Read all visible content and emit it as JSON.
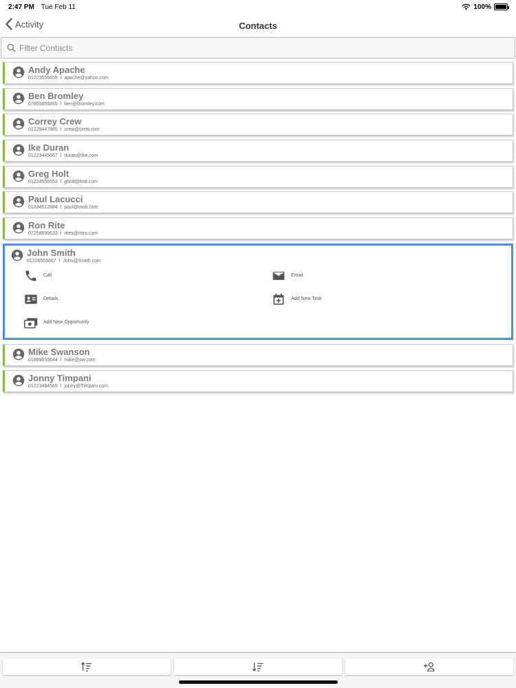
{
  "status_bar": {
    "time": "2:47 PM",
    "date": "Tue Feb 11",
    "battery": "100%"
  },
  "nav": {
    "back_label": "Activity",
    "title": "Contacts"
  },
  "search": {
    "placeholder": "Filter Contacts",
    "value": ""
  },
  "contacts": [
    {
      "name": "Andy Apache",
      "phone": "01223556655",
      "email": "apache@yahoo.com"
    },
    {
      "name": "Ben Bromley",
      "phone": "07855855855",
      "email": "ben@bromley.com"
    },
    {
      "name": "Correy Crew",
      "phone": "01225447885",
      "email": "crew@crew.com"
    },
    {
      "name": "Ike Duran",
      "phone": "01223445667",
      "email": "duran@ike.com"
    },
    {
      "name": "Greg Holt",
      "phone": "01224556553",
      "email": "gholt@holt.com"
    },
    {
      "name": "Paul Lacucci",
      "phone": "01334512884",
      "email": "paul@mob.com"
    },
    {
      "name": "Ron Rite",
      "phone": "07258699633",
      "email": "rites@rites.com"
    },
    {
      "name": "John Smith",
      "phone": "01226555667",
      "email": "John@Smith.com"
    },
    {
      "name": "Mike Swanson",
      "phone": "01999655644",
      "email": "mike@sw.com"
    },
    {
      "name": "Jonny Timpani",
      "phone": "01223484565",
      "email": "jonny@Timpani.com"
    }
  ],
  "contact_separator": "l",
  "expanded_actions": {
    "call": "Call",
    "email": "Email",
    "details": "Details",
    "add_task": "Add New Task",
    "add_opportunity": "Add New Opportunity"
  },
  "colors": {
    "accent_green": "#8dbb45",
    "selection_blue": "#4a90d9"
  },
  "toolbar": {
    "icons": [
      "sort-ascending-icon",
      "sort-descending-icon",
      "add-contact-icon"
    ]
  }
}
